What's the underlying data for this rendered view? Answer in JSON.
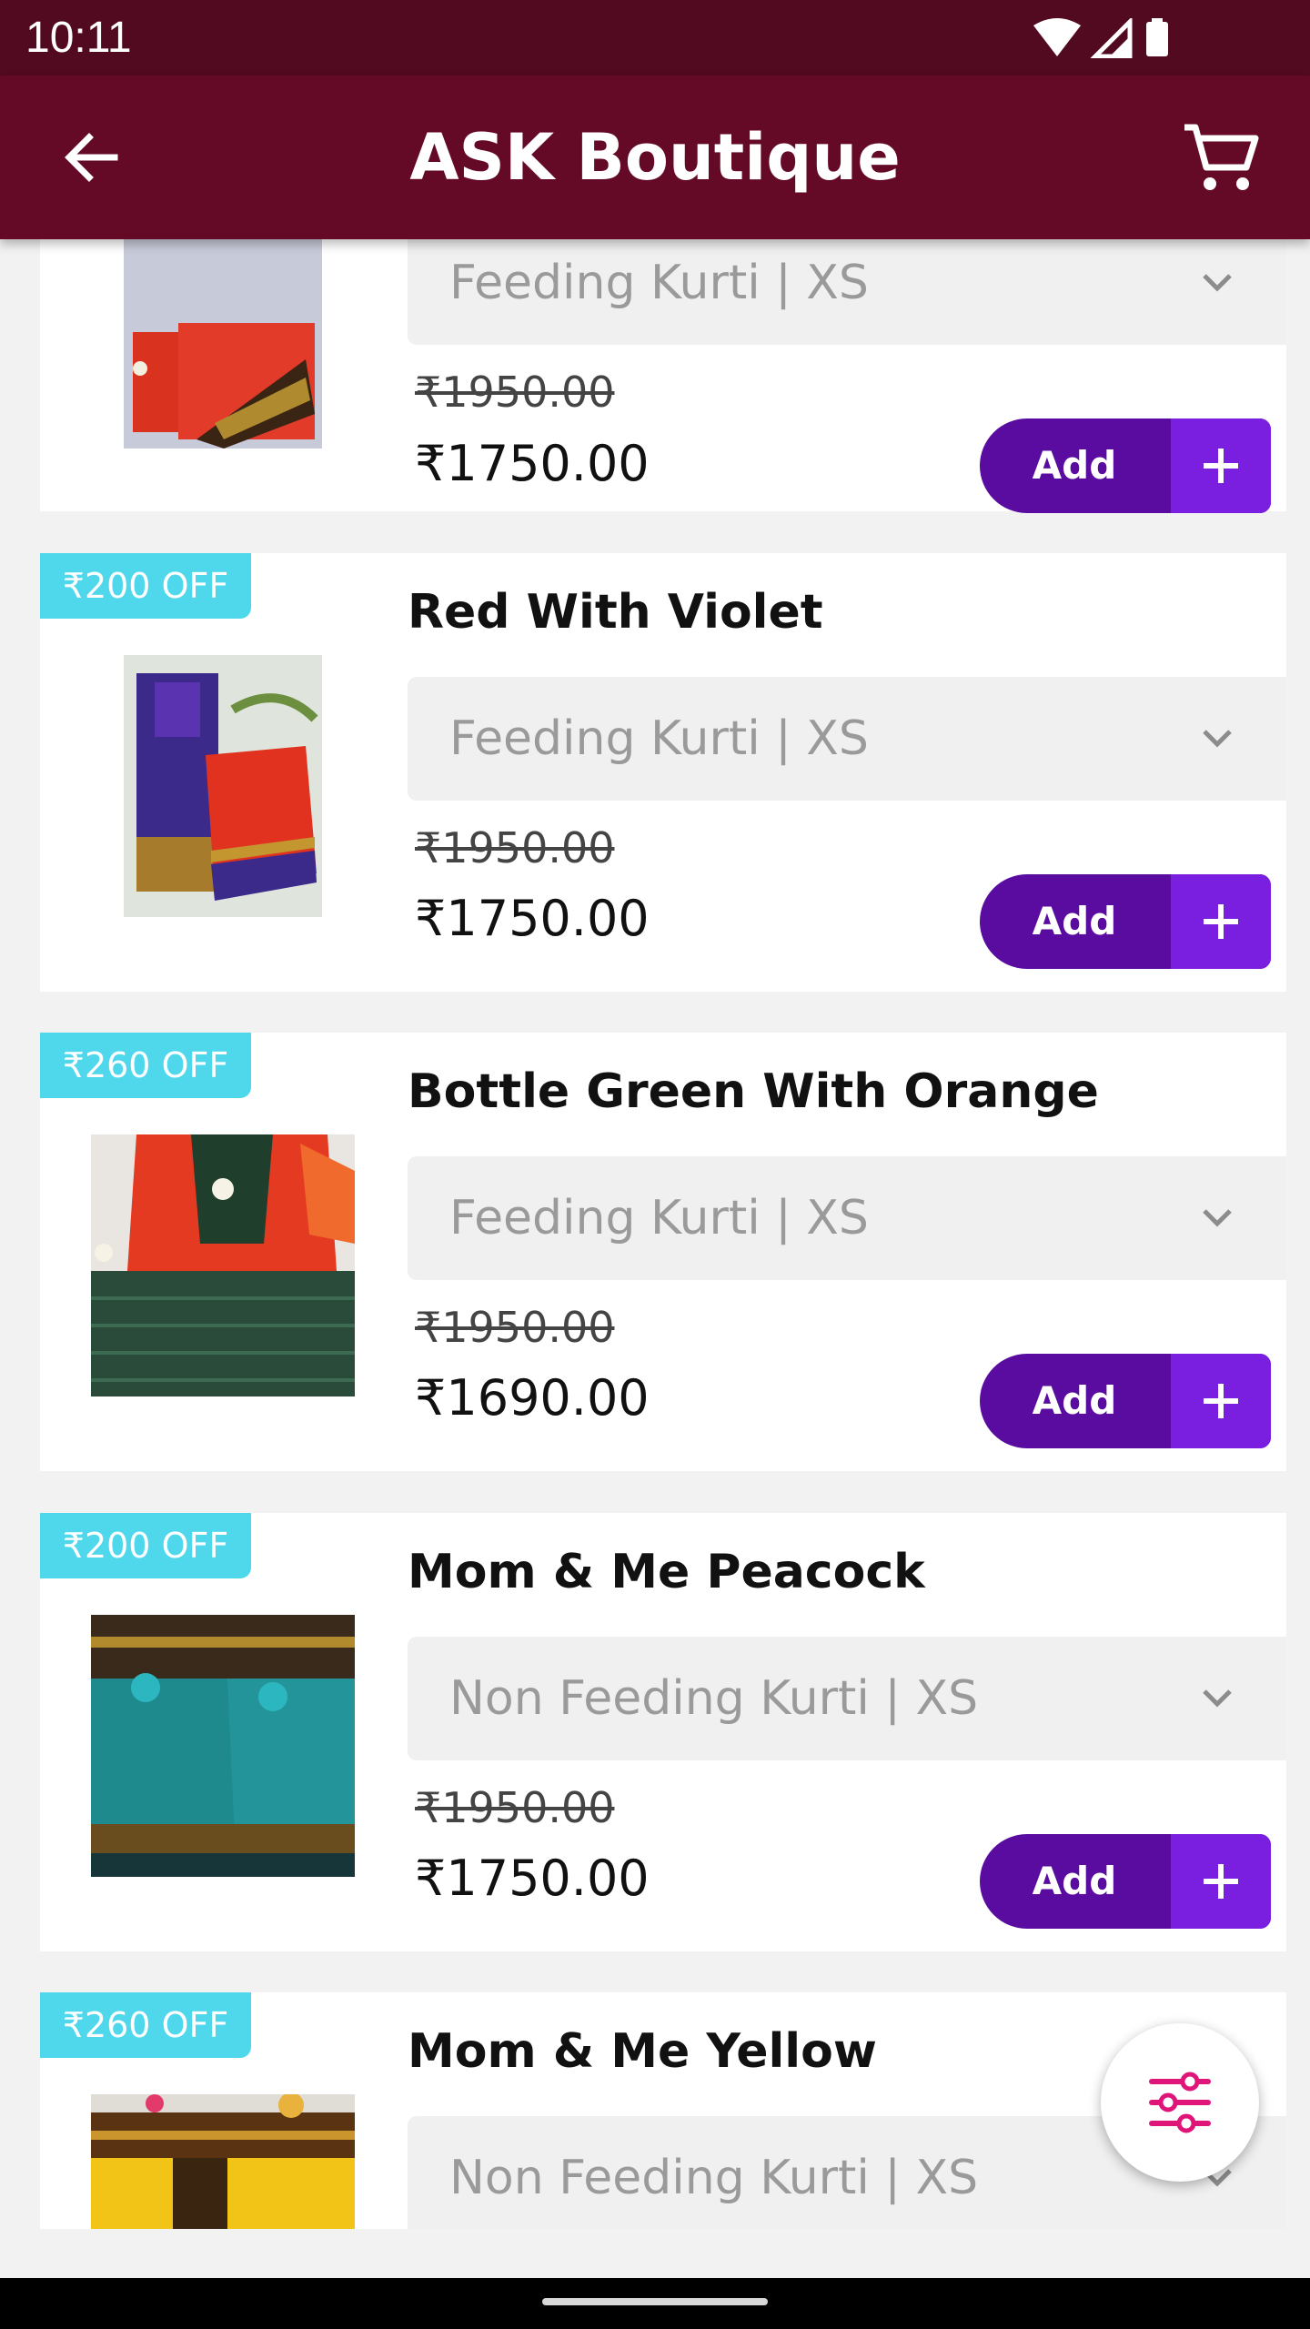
{
  "status_bar": {
    "time": "10:11"
  },
  "app_bar": {
    "title": "ASK Boutique"
  },
  "products": [
    {
      "discount": "",
      "title": "",
      "variant": "Feeding Kurti  | XS",
      "old_price": "₹1950.00",
      "price": "₹1750.00",
      "add_label": "Add"
    },
    {
      "discount": "₹200 OFF",
      "title": "Red With Violet",
      "variant": "Feeding Kurti  | XS",
      "old_price": "₹1950.00",
      "price": "₹1750.00",
      "add_label": "Add"
    },
    {
      "discount": "₹260 OFF",
      "title": "Bottle Green With Orange",
      "variant": "Feeding Kurti  | XS",
      "old_price": "₹1950.00",
      "price": "₹1690.00",
      "add_label": "Add"
    },
    {
      "discount": "₹200 OFF",
      "title": "Mom & Me Peacock",
      "variant": "Non Feeding Kurti  | XS",
      "old_price": "₹1950.00",
      "price": "₹1750.00",
      "add_label": "Add"
    },
    {
      "discount": "₹260 OFF",
      "title": "Mom & Me Yellow",
      "variant": "Non Feeding Kurti  | XS",
      "old_price": "",
      "price": "",
      "add_label": ""
    }
  ],
  "icons": {
    "back": "arrow-left-icon",
    "cart": "cart-icon",
    "filter": "sliders-icon",
    "dropdown": "chevron-down-icon"
  },
  "colors": {
    "status_bar": "#510a1f",
    "app_bar": "#650a26",
    "add_button": "#5a0ba0",
    "add_plus": "#7a1ee0",
    "discount_badge": "#4fd8ec",
    "filter_icon": "#e0157a"
  }
}
